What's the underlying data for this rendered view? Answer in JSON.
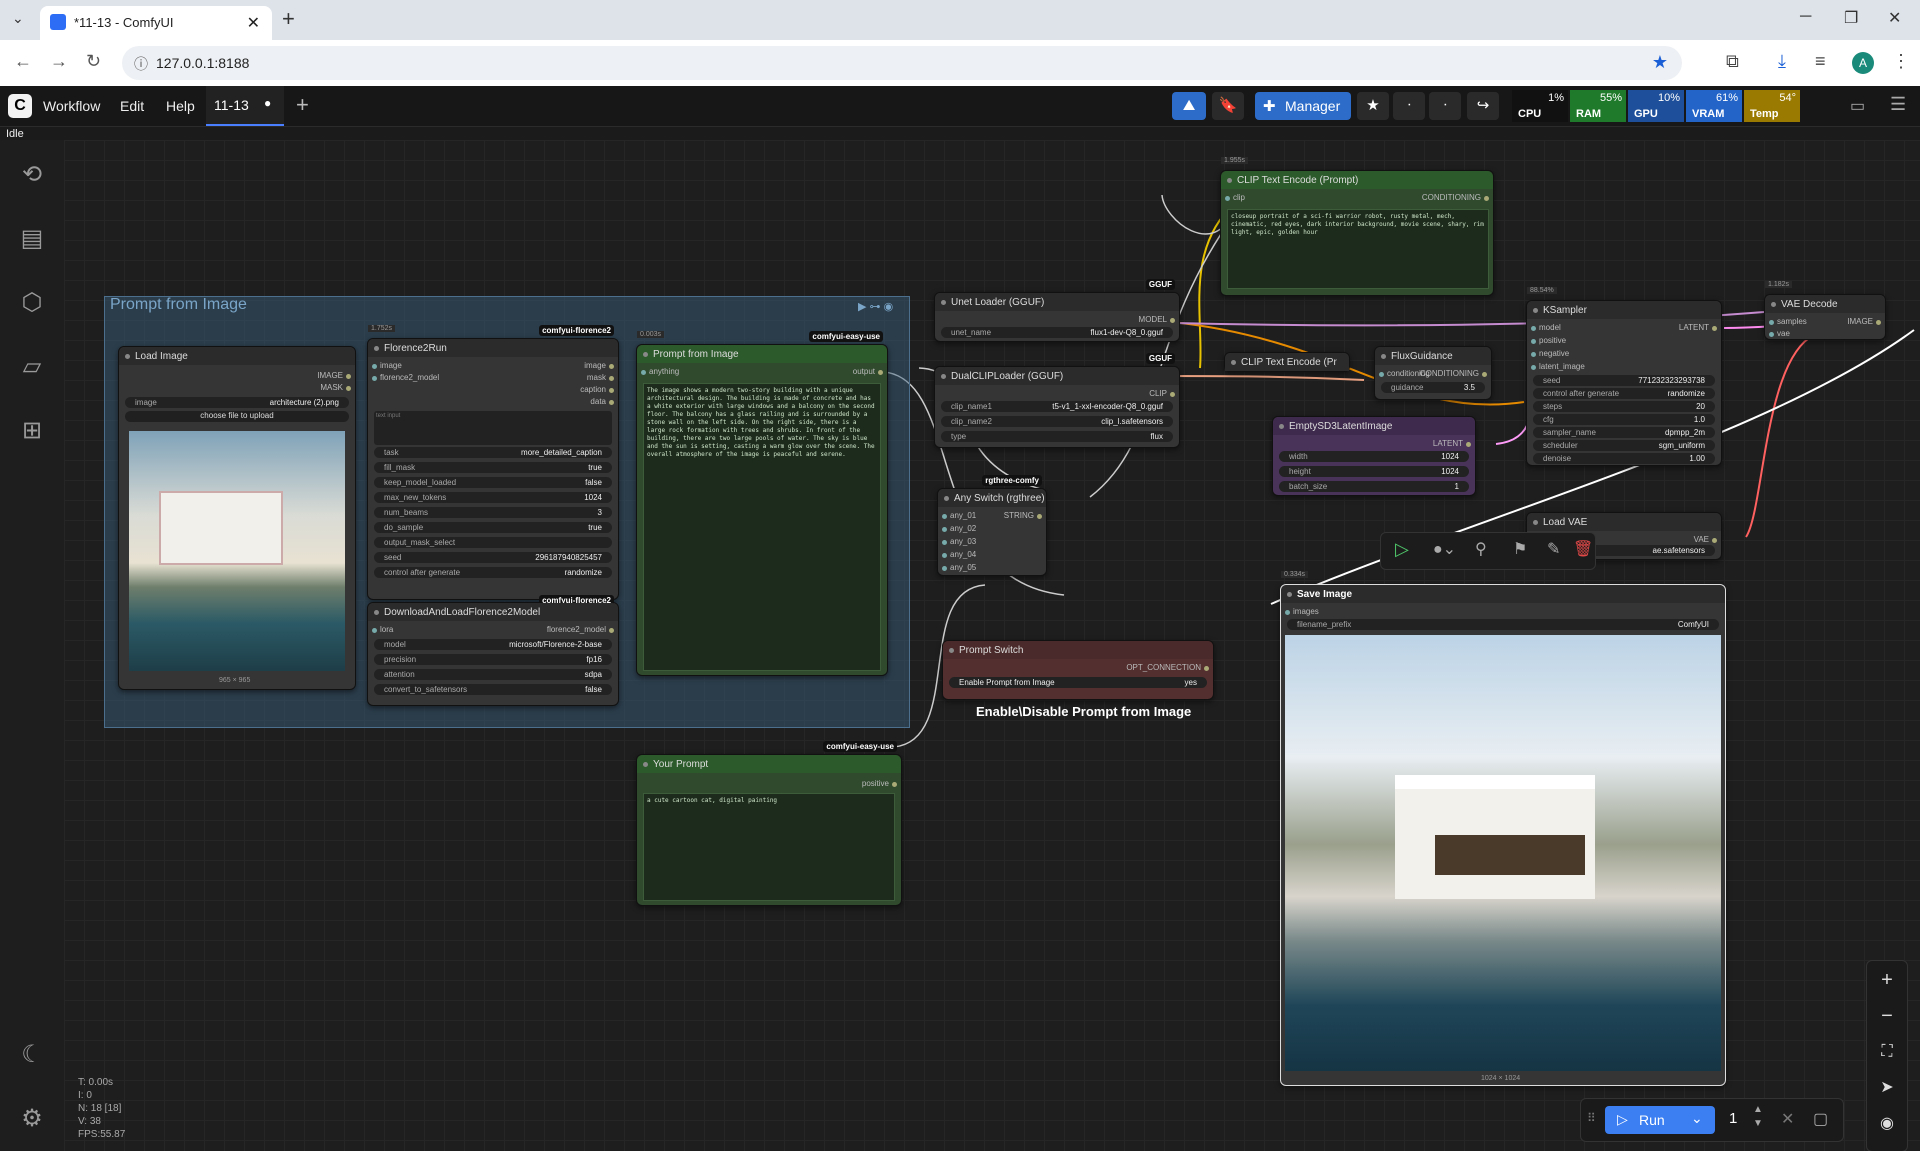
{
  "browser": {
    "tab_title": "*11-13 - ComfyUI",
    "url": "127.0.0.1:8188",
    "profile": "A"
  },
  "menu": {
    "items": [
      "Workflow",
      "Edit",
      "Help"
    ],
    "workflow_tab": "11-13",
    "manager_label": "Manager"
  },
  "resources": [
    {
      "name": "CPU",
      "value": "1%",
      "color": "#3a3a3a"
    },
    {
      "name": "RAM",
      "value": "55%",
      "color": "#1f7a2b"
    },
    {
      "name": "GPU",
      "value": "10%",
      "color": "#1d4f9a"
    },
    {
      "name": "VRAM",
      "value": "61%",
      "color": "#2364c8"
    },
    {
      "name": "Temp",
      "value": "54°",
      "color": "#9a7a00"
    }
  ],
  "status": "Idle",
  "group_title": "Prompt from Image",
  "nodes": {
    "load_image": {
      "title": "Load Image",
      "out1": "IMAGE",
      "out2": "MASK",
      "image_key": "image",
      "image_value": "architecture (2).png",
      "upload": "choose file to upload",
      "dims": "965 × 965"
    },
    "florence_run": {
      "title": "Florence2Run",
      "badge": "comfyui-florence2",
      "time": "1.752s",
      "inputs": [
        "image",
        "florence2_model"
      ],
      "outputs": [
        "image",
        "mask",
        "caption",
        "data"
      ],
      "text_placeholder": "text input",
      "widgets": [
        {
          "k": "task",
          "v": "more_detailed_caption"
        },
        {
          "k": "fill_mask",
          "v": "true"
        },
        {
          "k": "keep_model_loaded",
          "v": "false"
        },
        {
          "k": "max_new_tokens",
          "v": "1024"
        },
        {
          "k": "num_beams",
          "v": "3"
        },
        {
          "k": "do_sample",
          "v": "true"
        },
        {
          "k": "output_mask_select",
          "v": ""
        },
        {
          "k": "seed",
          "v": "296187940825457"
        },
        {
          "k": "control after generate",
          "v": "randomize"
        }
      ]
    },
    "download_florence": {
      "title": "DownloadAndLoadFlorence2Model",
      "badge": "comfyui-florence2",
      "input": "lora",
      "output": "florence2_model",
      "widgets": [
        {
          "k": "model",
          "v": "microsoft/Florence-2-base"
        },
        {
          "k": "precision",
          "v": "fp16"
        },
        {
          "k": "attention",
          "v": "sdpa"
        },
        {
          "k": "convert_to_safetensors",
          "v": "false"
        }
      ]
    },
    "prompt_from_image": {
      "title": "Prompt from Image",
      "badge": "comfyui-easy-use",
      "time": "0.003s",
      "input": "anything",
      "output": "output",
      "text": "The image shows a modern two-story building with a unique architectural design. The building is made of concrete and has a white exterior with large windows and a balcony on the second floor. The balcony has a glass railing and is surrounded by a stone wall on the left side. On the right side, there is a large rock formation with trees and shrubs. In front of the building, there are two large pools of water. The sky is blue and the sun is setting, casting a warm glow over the scene. The overall atmosphere of the image is peaceful and serene."
    },
    "your_prompt": {
      "title": "Your Prompt",
      "badge": "comfyui-easy-use",
      "output": "positive",
      "text": "a cute cartoon cat, digital painting"
    },
    "unet_loader": {
      "title": "Unet Loader (GGUF)",
      "badge": "GGUF",
      "output": "MODEL",
      "widget_k": "unet_name",
      "widget_v": "flux1-dev-Q8_0.gguf"
    },
    "dualclip": {
      "title": "DualCLIPLoader (GGUF)",
      "badge": "GGUF",
      "output": "CLIP",
      "widgets": [
        {
          "k": "clip_name1",
          "v": "t5-v1_1-xxl-encoder-Q8_0.gguf"
        },
        {
          "k": "clip_name2",
          "v": "clip_l.safetensors"
        },
        {
          "k": "type",
          "v": "flux"
        }
      ]
    },
    "any_switch": {
      "title": "Any Switch (rgthree)",
      "badge": "rgthree-comfy",
      "output": "STRING",
      "inputs": [
        "any_01",
        "any_02",
        "any_03",
        "any_04",
        "any_05"
      ]
    },
    "prompt_switch": {
      "title": "Prompt Switch",
      "output": "OPT_CONNECTION",
      "widget_k": "Enable Prompt from Image",
      "widget_v": "yes",
      "caption": "Enable\\Disable Prompt from Image"
    },
    "clip_encode_top": {
      "title": "CLIP Text Encode (Prompt)",
      "time": "1.955s",
      "input": "clip",
      "output": "CONDITIONING",
      "text": "closeup portrait of a sci-fi warrior robot, rusty metal, mech, cinematic, red eyes, dark interior background, movie scene, shary, rim light, epic, golden hour"
    },
    "clip_encode_small": {
      "title": "CLIP Text Encode (Pr"
    },
    "flux_guidance": {
      "title": "FluxGuidance",
      "input": "conditioning",
      "output": "CONDITIONING",
      "widget_k": "guidance",
      "widget_v": "3.5"
    },
    "empty_latent": {
      "title": "EmptySD3LatentImage",
      "output": "LATENT",
      "widgets": [
        {
          "k": "width",
          "v": "1024"
        },
        {
          "k": "height",
          "v": "1024"
        },
        {
          "k": "batch_size",
          "v": "1"
        }
      ]
    },
    "ksampler": {
      "title": "KSampler",
      "time": "88.54%",
      "inputs": [
        "model",
        "positive",
        "negative",
        "latent_image"
      ],
      "output": "LATENT",
      "widgets": [
        {
          "k": "seed",
          "v": "771232323293738"
        },
        {
          "k": "control after generate",
          "v": "randomize"
        },
        {
          "k": "steps",
          "v": "20"
        },
        {
          "k": "cfg",
          "v": "1.0"
        },
        {
          "k": "sampler_name",
          "v": "dpmpp_2m"
        },
        {
          "k": "scheduler",
          "v": "sgm_uniform"
        },
        {
          "k": "denoise",
          "v": "1.00"
        }
      ]
    },
    "vae_decode": {
      "title": "VAE Decode",
      "time": "1.182s",
      "inputs": [
        "samples",
        "vae"
      ],
      "output": "IMAGE"
    },
    "load_vae": {
      "title": "Load VAE",
      "output": "VAE",
      "widget_v": "ae.safetensors"
    },
    "save_image": {
      "title": "Save Image",
      "time": "0.334s",
      "input": "images",
      "widget_k": "filename_prefix",
      "widget_v": "ComfyUI",
      "dims": "1024 × 1024"
    }
  },
  "run": {
    "label": "Run",
    "count": "1"
  },
  "stats": "T: 0.00s\nI: 0\nN: 18 [18]\nV: 38\nFPS:55.87"
}
